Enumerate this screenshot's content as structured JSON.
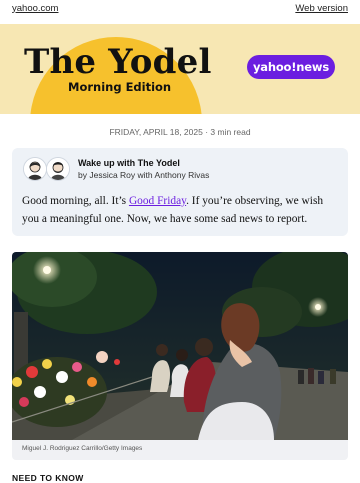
{
  "top_bar": {
    "left_link": "yahoo.com",
    "right_link": "Web version"
  },
  "banner": {
    "title": "The Yodel",
    "subtitle": "Morning Edition",
    "badge": "yahoo!news",
    "colors": {
      "background": "#f7e7b3",
      "sun": "#f6c12d",
      "badge": "#6b1ee0"
    }
  },
  "dateline": "FRIDAY, APRIL 18, 2025 · 3 min read",
  "intro": {
    "title": "Wake up with The Yodel",
    "byline": "by Jessica Roy with Anthony Rivas",
    "body_before": "Good morning, all. It’s ",
    "body_link": "Good Friday",
    "body_after": ". If you’re observing, we wish you a meaningful one. Now, we have some sad news to report."
  },
  "photo": {
    "caption": "Miguel J. Rodriguez Carrillo/Getty Images"
  },
  "section_heading": "NEED TO KNOW"
}
